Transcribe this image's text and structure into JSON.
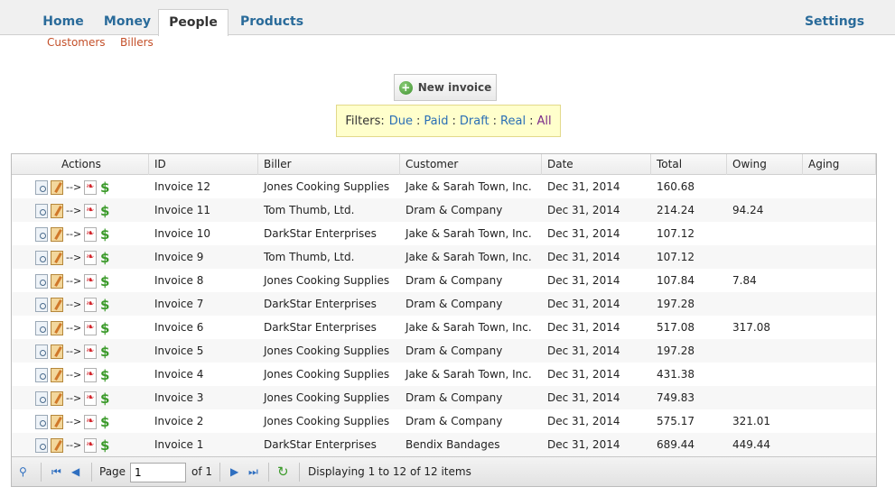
{
  "nav": {
    "tabs": [
      {
        "label": "Home",
        "active": false
      },
      {
        "label": "Money",
        "active": false
      },
      {
        "label": "People",
        "active": true
      },
      {
        "label": "Products",
        "active": false
      }
    ],
    "settings_label": "Settings",
    "subtabs": [
      "Customers",
      "Billers"
    ]
  },
  "new_invoice_label": "New invoice",
  "filters": {
    "label": "Filters:",
    "options": [
      "Due",
      "Paid",
      "Draft",
      "Real",
      "All"
    ]
  },
  "table": {
    "columns": [
      "Actions",
      "ID",
      "Biller",
      "Customer",
      "Date",
      "Total",
      "Owing",
      "Aging"
    ],
    "action_arrow": "-->",
    "action_icons": [
      "view-icon",
      "edit-icon",
      "pdf-icon",
      "payment-icon"
    ],
    "rows": [
      {
        "id": "Invoice 12",
        "biller": "Jones Cooking Supplies",
        "customer": "Jake & Sarah Town, Inc.",
        "date": "Dec 31, 2014",
        "total": "160.68",
        "owing": "",
        "aging": ""
      },
      {
        "id": "Invoice 11",
        "biller": "Tom Thumb, Ltd.",
        "customer": "Dram & Company",
        "date": "Dec 31, 2014",
        "total": "214.24",
        "owing": "94.24",
        "aging": ""
      },
      {
        "id": "Invoice 10",
        "biller": "DarkStar Enterprises",
        "customer": "Jake & Sarah Town, Inc.",
        "date": "Dec 31, 2014",
        "total": "107.12",
        "owing": "",
        "aging": ""
      },
      {
        "id": "Invoice 9",
        "biller": "Tom Thumb, Ltd.",
        "customer": "Jake & Sarah Town, Inc.",
        "date": "Dec 31, 2014",
        "total": "107.12",
        "owing": "",
        "aging": ""
      },
      {
        "id": "Invoice 8",
        "biller": "Jones Cooking Supplies",
        "customer": "Dram & Company",
        "date": "Dec 31, 2014",
        "total": "107.84",
        "owing": "7.84",
        "aging": ""
      },
      {
        "id": "Invoice 7",
        "biller": "DarkStar Enterprises",
        "customer": "Dram & Company",
        "date": "Dec 31, 2014",
        "total": "197.28",
        "owing": "",
        "aging": ""
      },
      {
        "id": "Invoice 6",
        "biller": "DarkStar Enterprises",
        "customer": "Jake & Sarah Town, Inc.",
        "date": "Dec 31, 2014",
        "total": "517.08",
        "owing": "317.08",
        "aging": ""
      },
      {
        "id": "Invoice 5",
        "biller": "Jones Cooking Supplies",
        "customer": "Dram & Company",
        "date": "Dec 31, 2014",
        "total": "197.28",
        "owing": "",
        "aging": ""
      },
      {
        "id": "Invoice 4",
        "biller": "Jones Cooking Supplies",
        "customer": "Jake & Sarah Town, Inc.",
        "date": "Dec 31, 2014",
        "total": "431.38",
        "owing": "",
        "aging": ""
      },
      {
        "id": "Invoice 3",
        "biller": "Jones Cooking Supplies",
        "customer": "Dram & Company",
        "date": "Dec 31, 2014",
        "total": "749.83",
        "owing": "",
        "aging": ""
      },
      {
        "id": "Invoice 2",
        "biller": "Jones Cooking Supplies",
        "customer": "Dram & Company",
        "date": "Dec 31, 2014",
        "total": "575.17",
        "owing": "321.01",
        "aging": ""
      },
      {
        "id": "Invoice 1",
        "biller": "DarkStar Enterprises",
        "customer": "Bendix Bandages",
        "date": "Dec 31, 2014",
        "total": "689.44",
        "owing": "449.44",
        "aging": ""
      }
    ]
  },
  "pager": {
    "page_label": "Page",
    "page_value": "1",
    "of_label": "of 1",
    "status": "Displaying 1 to 12 of 12 items"
  }
}
